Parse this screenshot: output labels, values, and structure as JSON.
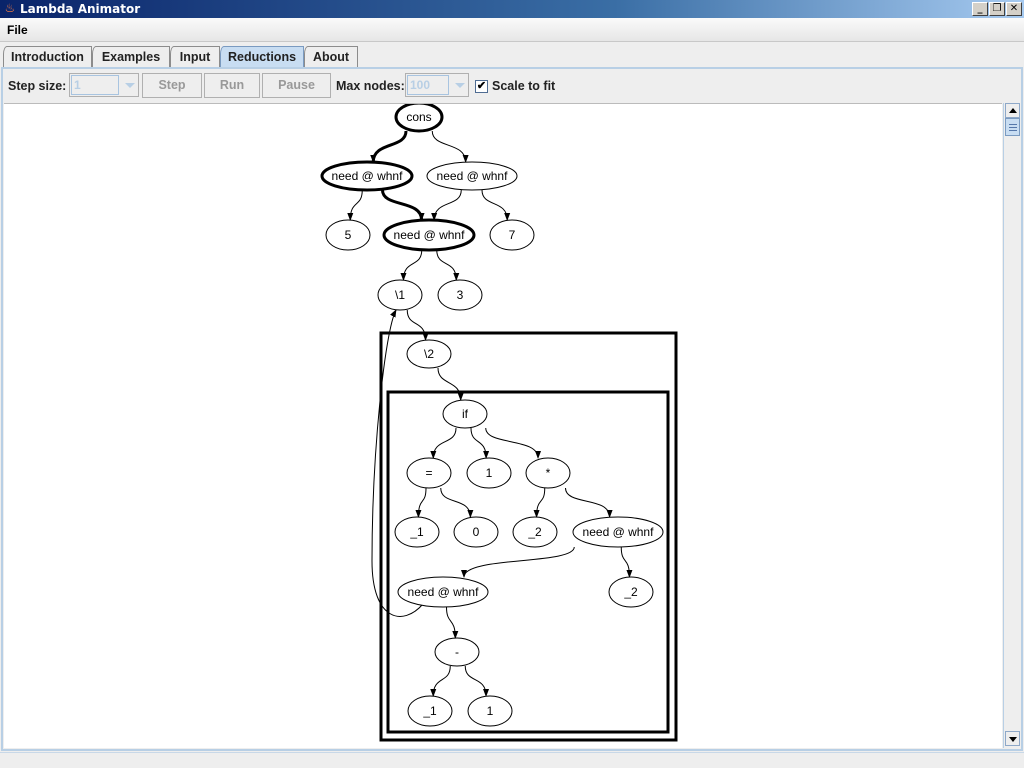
{
  "window": {
    "title": "Lambda Animator",
    "controls": [
      "_",
      "❐",
      "✕"
    ]
  },
  "menubar": {
    "items": [
      {
        "label": "File"
      }
    ]
  },
  "tabs": [
    {
      "label": "Introduction",
      "active": false
    },
    {
      "label": "Examples",
      "active": false
    },
    {
      "label": "Input",
      "active": false
    },
    {
      "label": "Reductions",
      "active": true
    },
    {
      "label": "About",
      "active": false
    }
  ],
  "toolbar": {
    "step_size_label": "Step size:",
    "step_size_value": "1",
    "step_label": "Step",
    "run_label": "Run",
    "pause_label": "Pause",
    "max_nodes_label": "Max nodes:",
    "max_nodes_value": "100",
    "scale_to_fit_label": "Scale to fit",
    "scale_to_fit_checked": true,
    "check_glyph": "✔"
  },
  "graph": {
    "nodes": [
      {
        "id": "cons",
        "label": "cons",
        "bold": true
      },
      {
        "id": "need1",
        "label": "need @ whnf",
        "bold": true
      },
      {
        "id": "need2",
        "label": "need @ whnf",
        "bold": false
      },
      {
        "id": "n5",
        "label": "5",
        "bold": false
      },
      {
        "id": "need3",
        "label": "need @ whnf",
        "bold": true
      },
      {
        "id": "n7",
        "label": "7",
        "bold": false
      },
      {
        "id": "lam1",
        "label": "\\1",
        "bold": false
      },
      {
        "id": "n3",
        "label": "3",
        "bold": false
      },
      {
        "id": "lam2",
        "label": "\\2",
        "bold": false
      },
      {
        "id": "if",
        "label": "if",
        "bold": false
      },
      {
        "id": "eq",
        "label": "=",
        "bold": false
      },
      {
        "id": "one_a",
        "label": "1",
        "bold": false
      },
      {
        "id": "mul",
        "label": "*",
        "bold": false
      },
      {
        "id": "v1a",
        "label": "_1",
        "bold": false
      },
      {
        "id": "zero",
        "label": "0",
        "bold": false
      },
      {
        "id": "v2a",
        "label": "_2",
        "bold": false
      },
      {
        "id": "need4",
        "label": "need @ whnf",
        "bold": false
      },
      {
        "id": "need5",
        "label": "need @ whnf",
        "bold": false
      },
      {
        "id": "v2b",
        "label": "_2",
        "bold": false
      },
      {
        "id": "minus",
        "label": "-",
        "bold": false
      },
      {
        "id": "v1b",
        "label": "_1",
        "bold": false
      },
      {
        "id": "one_b",
        "label": "1",
        "bold": false
      }
    ],
    "edges": [
      {
        "from": "cons",
        "to": "need1",
        "bold": true
      },
      {
        "from": "cons",
        "to": "need2",
        "bold": false
      },
      {
        "from": "need1",
        "to": "need3",
        "bold": true
      },
      {
        "from": "need1",
        "to": "n5",
        "bold": false
      },
      {
        "from": "need2",
        "to": "need3",
        "bold": false
      },
      {
        "from": "need2",
        "to": "n7",
        "bold": false
      },
      {
        "from": "need3",
        "to": "lam1",
        "bold": false
      },
      {
        "from": "need3",
        "to": "n3",
        "bold": false
      },
      {
        "from": "lam1",
        "to": "lam2",
        "bold": false
      },
      {
        "from": "lam2",
        "to": "if",
        "bold": false
      },
      {
        "from": "if",
        "to": "eq",
        "bold": false
      },
      {
        "from": "if",
        "to": "one_a",
        "bold": false
      },
      {
        "from": "if",
        "to": "mul",
        "bold": false
      },
      {
        "from": "eq",
        "to": "v1a",
        "bold": false
      },
      {
        "from": "eq",
        "to": "zero",
        "bold": false
      },
      {
        "from": "mul",
        "to": "v2a",
        "bold": false
      },
      {
        "from": "mul",
        "to": "need4",
        "bold": false
      },
      {
        "from": "need4",
        "to": "need5",
        "bold": false
      },
      {
        "from": "need4",
        "to": "v2b",
        "bold": false
      },
      {
        "from": "need5",
        "to": "minus",
        "bold": false
      },
      {
        "from": "need5",
        "to": "lam1",
        "bold": false
      },
      {
        "from": "minus",
        "to": "v1b",
        "bold": false
      },
      {
        "from": "minus",
        "to": "one_b",
        "bold": false
      }
    ],
    "clusters": [
      {
        "id": "scope-outer",
        "contains": "lam2"
      },
      {
        "id": "scope-inner",
        "contains": "if"
      }
    ]
  }
}
